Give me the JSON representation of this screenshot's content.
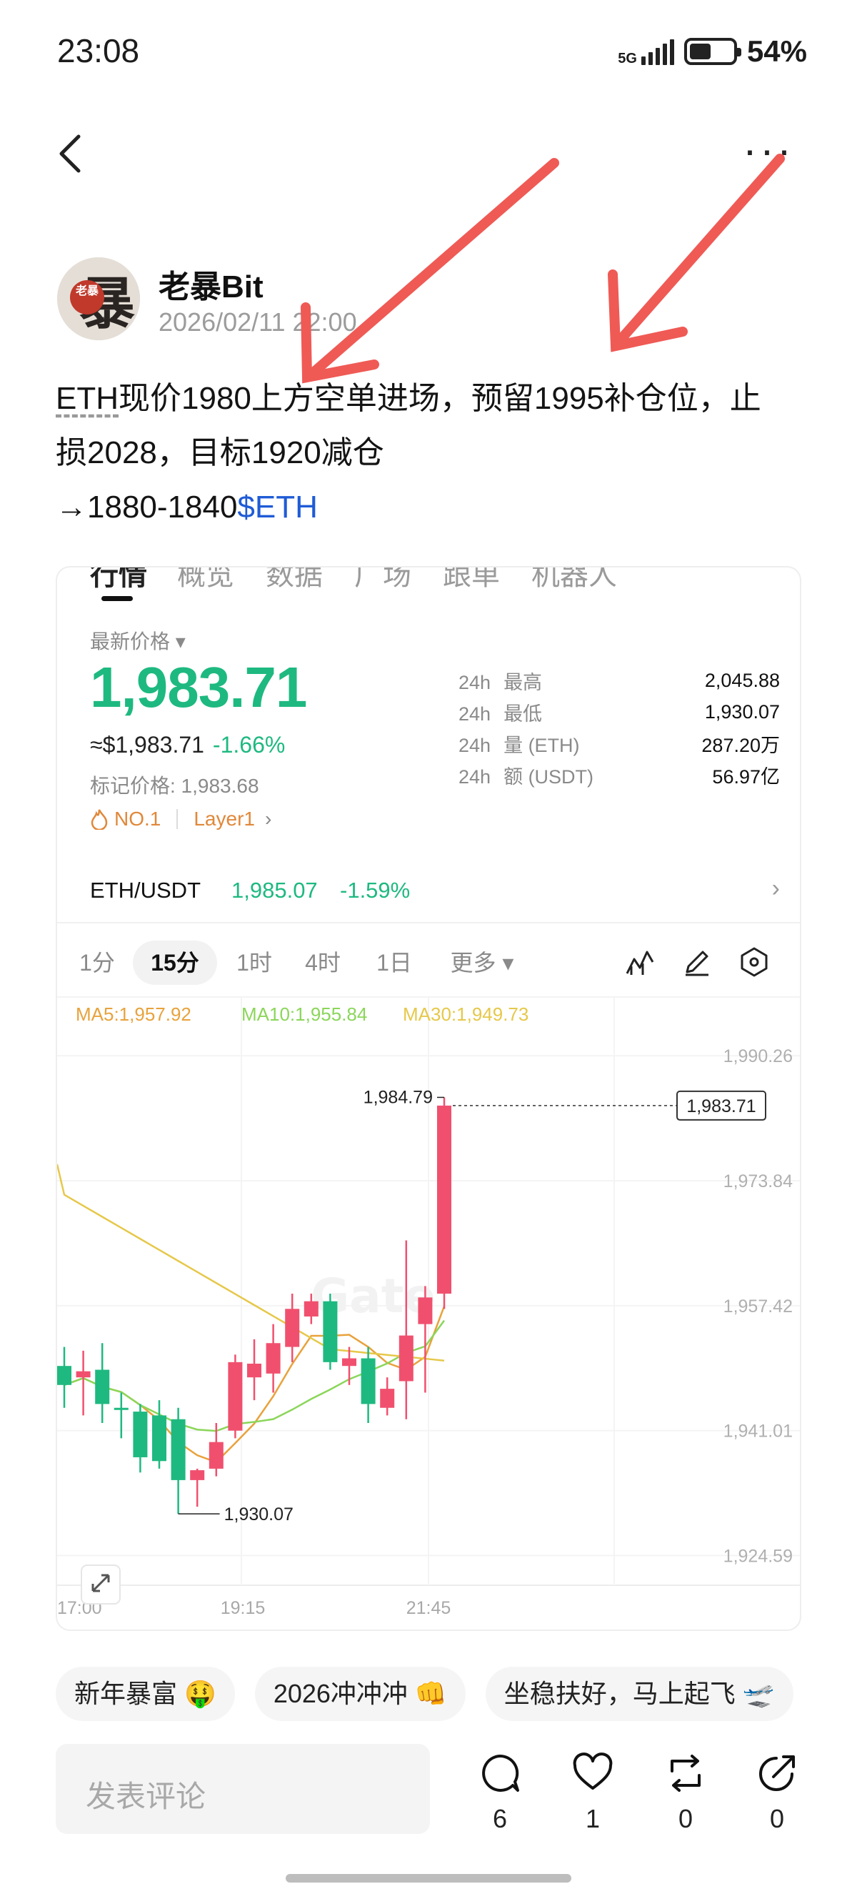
{
  "status_bar": {
    "time": "23:08",
    "network": "5G",
    "battery": "54%"
  },
  "author": {
    "name": "老暴Bit",
    "time": "2026/02/11 22:00",
    "avatar_text": "老暴"
  },
  "post": {
    "eth_word": "ETH",
    "text_main": "现价1980上方空单进场，预留1995补仓位，止损2028，目标1920减仓",
    "text_tail": "→1880-1840",
    "tag": "$ETH"
  },
  "card": {
    "tabs": [
      "行情",
      "概览",
      "数据",
      "广场",
      "跟单",
      "机器人"
    ],
    "latest_label": "最新价格",
    "price": "1,983.71",
    "usd_price": "≈$1,983.71",
    "change": "-1.66%",
    "mark_price": "标记价格: 1,983.68",
    "badges": [
      "NO.1",
      "Layer1"
    ],
    "stats": [
      {
        "pre": "24h",
        "label": "最高",
        "value": "2,045.88"
      },
      {
        "pre": "24h",
        "label": "最低",
        "value": "1,930.07"
      },
      {
        "pre": "24h",
        "label": "量 (ETH)",
        "value": "287.20万"
      },
      {
        "pre": "24h",
        "label": "额 (USDT)",
        "value": "56.97亿"
      }
    ],
    "pair": {
      "name": "ETH/USDT",
      "price": "1,985.07",
      "change": "-1.59%"
    },
    "timeframes": [
      "1分",
      "15分",
      "1时",
      "4时",
      "1日",
      "更多"
    ],
    "active_timeframe": "15分"
  },
  "chart_data": {
    "type": "candlestick",
    "ma_labels": {
      "ma5": "MA5:1,957.92",
      "ma10": "MA10:1,955.84",
      "ma30": "MA30:1,949.73"
    },
    "y_ticks": [
      "1,990.26",
      "1,973.84",
      "1,957.42",
      "1,941.01",
      "1,924.59"
    ],
    "y_tick_values": [
      1990.26,
      1973.84,
      1957.42,
      1941.01,
      1924.59
    ],
    "x_ticks": [
      "17:00",
      "19:15",
      "21:45"
    ],
    "high_label": "1,984.79",
    "low_label": "1,930.07",
    "current_label": "1,983.71",
    "candles": [
      {
        "o": 1949.5,
        "h": 1952.0,
        "l": 1944.0,
        "c": 1947.0
      },
      {
        "o": 1948.0,
        "h": 1951.5,
        "l": 1943.0,
        "c": 1948.8
      },
      {
        "o": 1949.0,
        "h": 1952.5,
        "l": 1942.0,
        "c": 1944.5
      },
      {
        "o": 1944.0,
        "h": 1946.0,
        "l": 1940.0,
        "c": 1944.0
      },
      {
        "o": 1943.5,
        "h": 1944.5,
        "l": 1935.5,
        "c": 1937.5
      },
      {
        "o": 1943.0,
        "h": 1945.0,
        "l": 1936.0,
        "c": 1937.0
      },
      {
        "o": 1942.5,
        "h": 1944.0,
        "l": 1930.07,
        "c": 1934.5
      },
      {
        "o": 1934.5,
        "h": 1936.0,
        "l": 1931.0,
        "c": 1935.8
      },
      {
        "o": 1936.0,
        "h": 1942.0,
        "l": 1935.0,
        "c": 1939.5
      },
      {
        "o": 1941.0,
        "h": 1951.0,
        "l": 1940.0,
        "c": 1950.0
      },
      {
        "o": 1948.0,
        "h": 1953.0,
        "l": 1945.0,
        "c": 1949.8
      },
      {
        "o": 1948.5,
        "h": 1955.0,
        "l": 1946.0,
        "c": 1952.5
      },
      {
        "o": 1952.0,
        "h": 1959.0,
        "l": 1950.0,
        "c": 1957.0
      },
      {
        "o": 1956.0,
        "h": 1959.0,
        "l": 1955.0,
        "c": 1958.0
      },
      {
        "o": 1958.0,
        "h": 1959.0,
        "l": 1949.0,
        "c": 1950.0
      },
      {
        "o": 1949.5,
        "h": 1952.0,
        "l": 1947.0,
        "c": 1950.5
      },
      {
        "o": 1950.5,
        "h": 1952.0,
        "l": 1942.0,
        "c": 1944.5
      },
      {
        "o": 1944.0,
        "h": 1948.0,
        "l": 1943.0,
        "c": 1946.5
      },
      {
        "o": 1947.5,
        "h": 1966.0,
        "l": 1942.5,
        "c": 1953.5
      },
      {
        "o": 1955.0,
        "h": 1960.0,
        "l": 1946.0,
        "c": 1958.5
      },
      {
        "o": 1959.0,
        "h": 1984.79,
        "l": 1957.0,
        "c": 1983.71
      }
    ],
    "up_color": "#f0506e",
    "down_color": "#1eb980",
    "ma5_color": "#e8a23c",
    "ma10_color": "#8bd65a",
    "ma30_color": "#e6c84a"
  },
  "chips": [
    "新年暴富 🤑",
    "2026冲冲冲 👊",
    "坐稳扶好，马上起飞 🛫"
  ],
  "bottom": {
    "comment_placeholder": "发表评论",
    "comments": "6",
    "likes": "1",
    "reposts": "0",
    "shares": "0"
  },
  "colors": {
    "green": "#1eb980",
    "red": "#f0506e",
    "tag_blue": "#1f5bd6",
    "arrow": "#ef5a55"
  }
}
